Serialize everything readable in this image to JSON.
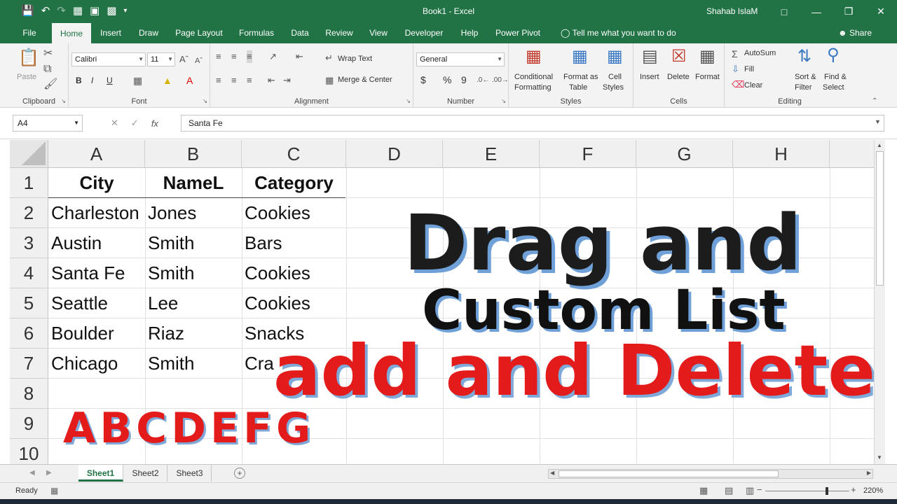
{
  "window": {
    "title": "Book1  -  Excel",
    "user": "Shahab IslaM",
    "qat_icons": [
      "save-icon",
      "undo-icon",
      "redo-icon",
      "form-icon",
      "camera-icon",
      "calculator-icon",
      "customize-icon"
    ]
  },
  "tabs": [
    "File",
    "Home",
    "Insert",
    "Draw",
    "Page Layout",
    "Formulas",
    "Data",
    "Review",
    "View",
    "Developer",
    "Help",
    "Power Pivot"
  ],
  "active_tab": "Home",
  "tell_me": "Tell me what you want to do",
  "share": "Share",
  "ribbon": {
    "clipboard": {
      "label": "Clipboard",
      "paste": "Paste"
    },
    "font": {
      "label": "Font",
      "name": "Calibri",
      "size": "11",
      "bold": "B",
      "italic": "I",
      "underline": "U"
    },
    "alignment": {
      "label": "Alignment",
      "wrap": "Wrap Text",
      "merge": "Merge & Center"
    },
    "number": {
      "label": "Number",
      "format": "General",
      "currency": "$",
      "percent": "%",
      "comma": "9"
    },
    "styles": {
      "label": "Styles",
      "conditional": "Conditional",
      "conditional2": "Formatting",
      "format_as": "Format as",
      "format_as2": "Table",
      "cell": "Cell",
      "cell2": "Styles"
    },
    "cells": {
      "label": "Cells",
      "insert": "Insert",
      "delete": "Delete",
      "format": "Format"
    },
    "editing": {
      "label": "Editing",
      "autosum": "AutoSum",
      "fill": "Fill",
      "clear": "Clear",
      "sort": "Sort &",
      "sort2": "Filter",
      "find": "Find &",
      "find2": "Select"
    }
  },
  "formula_bar": {
    "name_box": "A4",
    "fx": "fx",
    "value": "Santa Fe"
  },
  "columns": [
    "A",
    "B",
    "C",
    "D",
    "E",
    "F",
    "G",
    "H"
  ],
  "rows": [
    "1",
    "2",
    "3",
    "4",
    "5",
    "6",
    "7",
    "8",
    "9",
    "10"
  ],
  "table": {
    "headers": [
      "City",
      "NameL",
      "Category"
    ],
    "data": [
      [
        "Charleston",
        "Jones",
        "Cookies"
      ],
      [
        "Austin",
        "Smith",
        "Bars"
      ],
      [
        "Santa Fe",
        "Smith",
        "Cookies"
      ],
      [
        "Seattle",
        "Lee",
        "Cookies"
      ],
      [
        "Boulder",
        "Riaz",
        "Snacks"
      ],
      [
        "Chicago",
        "Smith",
        "Cra"
      ]
    ]
  },
  "overlay": {
    "line1": "Drag and",
    "line2": "Custom List",
    "line3": "add and Delete",
    "letters": "ABCDEFG"
  },
  "sheets": [
    "Sheet1",
    "Sheet2",
    "Sheet3"
  ],
  "active_sheet": "Sheet1",
  "status": {
    "ready": "Ready",
    "zoom": "220%"
  },
  "colors": {
    "excel_green": "#217346",
    "overlay_red": "#e31b1b",
    "shadow_blue": "#6fa0d8"
  }
}
